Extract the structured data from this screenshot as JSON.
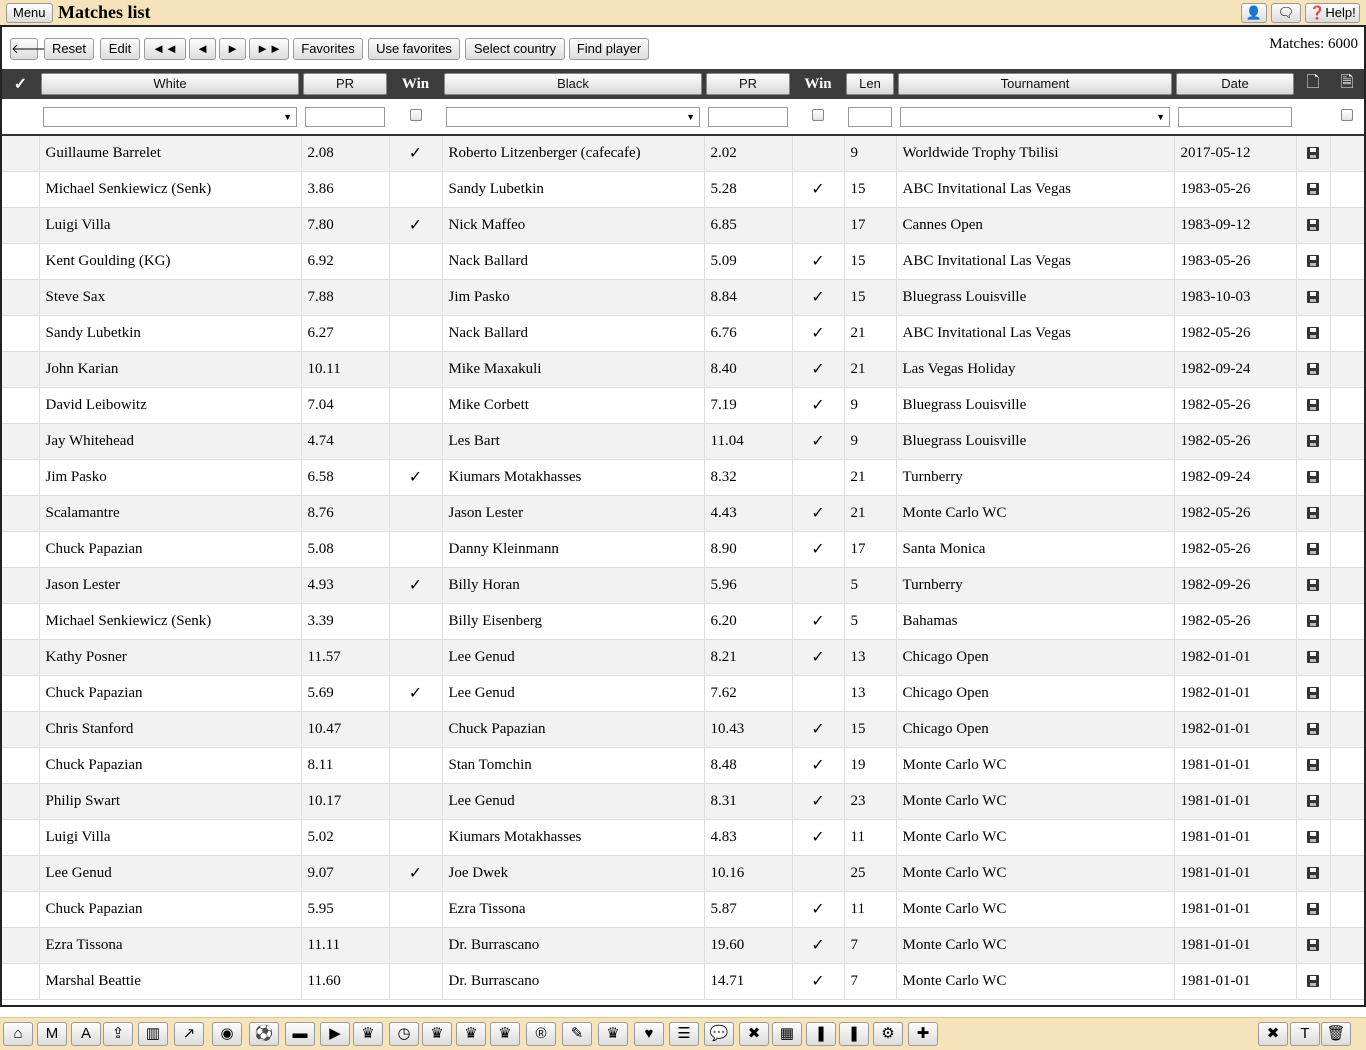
{
  "header": {
    "menu_label": "Menu",
    "title": "Matches list",
    "right_buttons": [
      {
        "name": "user-icon",
        "label": "👤"
      },
      {
        "name": "chat-icon",
        "label": "🗨"
      },
      {
        "name": "help-button",
        "label": "❓Help!"
      }
    ]
  },
  "toolbar": {
    "back_label": "🡐",
    "reset_label": "Reset",
    "edit_label": "Edit",
    "first_label": "◄◄",
    "prev_label": "◄",
    "next_label": "►",
    "last_label": "►►",
    "favorites_label": "Favorites",
    "use_favorites_label": "Use favorites",
    "select_country_label": "Select country",
    "find_player_label": "Find player",
    "matches_count": "Matches: 6000"
  },
  "columns": {
    "check": "✓",
    "white": "White",
    "pr1": "PR",
    "win1": "Win",
    "black": "Black",
    "pr2": "PR",
    "win2": "Win",
    "len": "Len",
    "tournament": "Tournament",
    "date": "Date",
    "doc_icon": "🗋",
    "export_icon": "🗎"
  },
  "check_mark": "✓",
  "rows": [
    {
      "white": "Guillaume Barrelet",
      "pr1": "2.08",
      "win1": "✓",
      "black": "Roberto Litzenberger (cafecafe)",
      "pr2": "2.02",
      "win2": "",
      "len": "9",
      "tournament": "Worldwide Trophy Tbilisi",
      "date": "2017-05-12"
    },
    {
      "white": "Michael Senkiewicz (Senk)",
      "pr1": "3.86",
      "win1": "",
      "black": "Sandy Lubetkin",
      "pr2": "5.28",
      "win2": "✓",
      "len": "15",
      "tournament": "ABC Invitational Las Vegas",
      "date": "1983-05-26"
    },
    {
      "white": "Luigi Villa",
      "pr1": "7.80",
      "win1": "✓",
      "black": "Nick Maffeo",
      "pr2": "6.85",
      "win2": "",
      "len": "17",
      "tournament": "Cannes Open",
      "date": "1983-09-12"
    },
    {
      "white": "Kent Goulding (KG)",
      "pr1": "6.92",
      "win1": "",
      "black": "Nack Ballard",
      "pr2": "5.09",
      "win2": "✓",
      "len": "15",
      "tournament": "ABC Invitational Las Vegas",
      "date": "1983-05-26"
    },
    {
      "white": "Steve Sax",
      "pr1": "7.88",
      "win1": "",
      "black": "Jim Pasko",
      "pr2": "8.84",
      "win2": "✓",
      "len": "15",
      "tournament": "Bluegrass Louisville",
      "date": "1983-10-03"
    },
    {
      "white": "Sandy Lubetkin",
      "pr1": "6.27",
      "win1": "",
      "black": "Nack Ballard",
      "pr2": "6.76",
      "win2": "✓",
      "len": "21",
      "tournament": "ABC Invitational Las Vegas",
      "date": "1982-05-26"
    },
    {
      "white": "John Karian",
      "pr1": "10.11",
      "win1": "",
      "black": "Mike Maxakuli",
      "pr2": "8.40",
      "win2": "✓",
      "len": "21",
      "tournament": "Las Vegas Holiday",
      "date": "1982-09-24"
    },
    {
      "white": "David Leibowitz",
      "pr1": "7.04",
      "win1": "",
      "black": "Mike Corbett",
      "pr2": "7.19",
      "win2": "✓",
      "len": "9",
      "tournament": "Bluegrass Louisville",
      "date": "1982-05-26"
    },
    {
      "white": "Jay Whitehead",
      "pr1": "4.74",
      "win1": "",
      "black": "Les Bart",
      "pr2": "11.04",
      "win2": "✓",
      "len": "9",
      "tournament": "Bluegrass Louisville",
      "date": "1982-05-26"
    },
    {
      "white": "Jim Pasko",
      "pr1": "6.58",
      "win1": "✓",
      "black": "Kiumars Motakhasses",
      "pr2": "8.32",
      "win2": "",
      "len": "21",
      "tournament": "Turnberry",
      "date": "1982-09-24"
    },
    {
      "white": "Scalamantre",
      "pr1": "8.76",
      "win1": "",
      "black": "Jason Lester",
      "pr2": "4.43",
      "win2": "✓",
      "len": "21",
      "tournament": "Monte Carlo WC",
      "date": "1982-05-26"
    },
    {
      "white": "Chuck Papazian",
      "pr1": "5.08",
      "win1": "",
      "black": "Danny Kleinmann",
      "pr2": "8.90",
      "win2": "✓",
      "len": "17",
      "tournament": "Santa Monica",
      "date": "1982-05-26"
    },
    {
      "white": "Jason Lester",
      "pr1": "4.93",
      "win1": "✓",
      "black": "Billy Horan",
      "pr2": "5.96",
      "win2": "",
      "len": "5",
      "tournament": "Turnberry",
      "date": "1982-09-26"
    },
    {
      "white": "Michael Senkiewicz (Senk)",
      "pr1": "3.39",
      "win1": "",
      "black": "Billy Eisenberg",
      "pr2": "6.20",
      "win2": "✓",
      "len": "5",
      "tournament": "Bahamas",
      "date": "1982-05-26"
    },
    {
      "white": "Kathy Posner",
      "pr1": "11.57",
      "win1": "",
      "black": "Lee Genud",
      "pr2": "8.21",
      "win2": "✓",
      "len": "13",
      "tournament": "Chicago Open",
      "date": "1982-01-01"
    },
    {
      "white": "Chuck Papazian",
      "pr1": "5.69",
      "win1": "✓",
      "black": "Lee Genud",
      "pr2": "7.62",
      "win2": "",
      "len": "13",
      "tournament": "Chicago Open",
      "date": "1982-01-01"
    },
    {
      "white": "Chris Stanford",
      "pr1": "10.47",
      "win1": "",
      "black": "Chuck Papazian",
      "pr2": "10.43",
      "win2": "✓",
      "len": "15",
      "tournament": "Chicago Open",
      "date": "1982-01-01"
    },
    {
      "white": "Chuck Papazian",
      "pr1": "8.11",
      "win1": "",
      "black": "Stan Tomchin",
      "pr2": "8.48",
      "win2": "✓",
      "len": "19",
      "tournament": "Monte Carlo WC",
      "date": "1981-01-01"
    },
    {
      "white": "Philip Swart",
      "pr1": "10.17",
      "win1": "",
      "black": "Lee Genud",
      "pr2": "8.31",
      "win2": "✓",
      "len": "23",
      "tournament": "Monte Carlo WC",
      "date": "1981-01-01"
    },
    {
      "white": "Luigi Villa",
      "pr1": "5.02",
      "win1": "",
      "black": "Kiumars Motakhasses",
      "pr2": "4.83",
      "win2": "✓",
      "len": "11",
      "tournament": "Monte Carlo WC",
      "date": "1981-01-01"
    },
    {
      "white": "Lee Genud",
      "pr1": "9.07",
      "win1": "✓",
      "black": "Joe Dwek",
      "pr2": "10.16",
      "win2": "",
      "len": "25",
      "tournament": "Monte Carlo WC",
      "date": "1981-01-01"
    },
    {
      "white": "Chuck Papazian",
      "pr1": "5.95",
      "win1": "",
      "black": "Ezra Tissona",
      "pr2": "5.87",
      "win2": "✓",
      "len": "11",
      "tournament": "Monte Carlo WC",
      "date": "1981-01-01"
    },
    {
      "white": "Ezra Tissona",
      "pr1": "11.11",
      "win1": "",
      "black": "Dr. Burrascano",
      "pr2": "19.60",
      "win2": "✓",
      "len": "7",
      "tournament": "Monte Carlo WC",
      "date": "1981-01-01"
    },
    {
      "white": "Marshal Beattie",
      "pr1": "11.60",
      "win1": "",
      "black": "Dr. Burrascano",
      "pr2": "14.71",
      "win2": "✓",
      "len": "7",
      "tournament": "Monte Carlo WC",
      "date": "1981-01-01"
    }
  ],
  "bottom_left": [
    {
      "name": "home-icon",
      "glyph": "⌂"
    },
    {
      "name": "m-button",
      "glyph": "M"
    },
    {
      "name": "a-button",
      "glyph": "A"
    },
    {
      "name": "upload-icon",
      "glyph": "⇪"
    },
    {
      "name": "bar-chart-icon",
      "glyph": "▥"
    },
    {
      "name": "line-chart-icon",
      "glyph": "↗"
    },
    {
      "name": "eye-icon",
      "glyph": "◉"
    },
    {
      "name": "soccer-ball-icon",
      "glyph": "⚽"
    },
    {
      "name": "archive-icon",
      "glyph": "▬"
    },
    {
      "name": "play-icon",
      "glyph": "▶"
    },
    {
      "name": "trophy-icon",
      "glyph": "♛"
    },
    {
      "name": "clock-icon",
      "glyph": "◷"
    },
    {
      "name": "trophy-icon-2",
      "glyph": "♛"
    },
    {
      "name": "trophy-icon-3",
      "glyph": "♛"
    },
    {
      "name": "trophy-icon-4",
      "glyph": "♛"
    },
    {
      "name": "registered-icon",
      "glyph": "®"
    },
    {
      "name": "edit-icon",
      "glyph": "✎"
    },
    {
      "name": "trophy-icon-5",
      "glyph": "♛"
    },
    {
      "name": "heart-icon",
      "glyph": "♥"
    },
    {
      "name": "database-icon",
      "glyph": "☰"
    },
    {
      "name": "comments-icon",
      "glyph": "💬"
    },
    {
      "name": "close-icon",
      "glyph": "✖"
    },
    {
      "name": "film-icon",
      "glyph": "▦"
    },
    {
      "name": "bookmark-icon",
      "glyph": "❚"
    },
    {
      "name": "bookmark-icon-2",
      "glyph": "❚"
    },
    {
      "name": "settings-icon",
      "glyph": "⚙"
    },
    {
      "name": "plus-icon",
      "glyph": "✚"
    }
  ],
  "bottom_right": [
    {
      "name": "close-icon-right",
      "glyph": "✖"
    },
    {
      "name": "text-icon",
      "glyph": "T"
    },
    {
      "name": "trash-icon",
      "glyph": "🗑"
    }
  ]
}
